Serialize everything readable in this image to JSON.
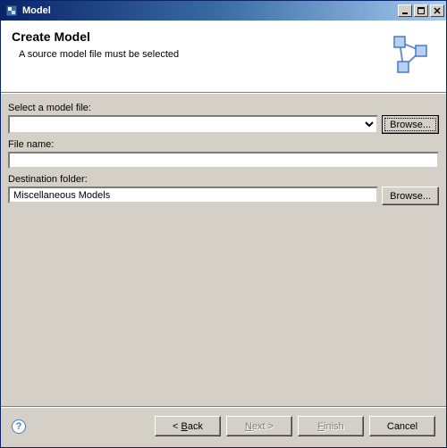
{
  "window": {
    "title": "Model"
  },
  "header": {
    "title": "Create Model",
    "subtitle": "A source model file must be selected"
  },
  "form": {
    "select_model_label": "Select a model file:",
    "model_file_value": "",
    "browse1_label": "Browse...",
    "file_name_label": "File name:",
    "file_name_value": "",
    "destination_label": "Destination folder:",
    "destination_value": "Miscellaneous Models",
    "browse2_label": "Browse..."
  },
  "footer": {
    "back_prefix": "< ",
    "back_accel": "B",
    "back_suffix": "ack",
    "next_accel": "N",
    "next_suffix": "ext >",
    "finish_accel": "F",
    "finish_suffix": "inish",
    "cancel_label": "Cancel"
  }
}
